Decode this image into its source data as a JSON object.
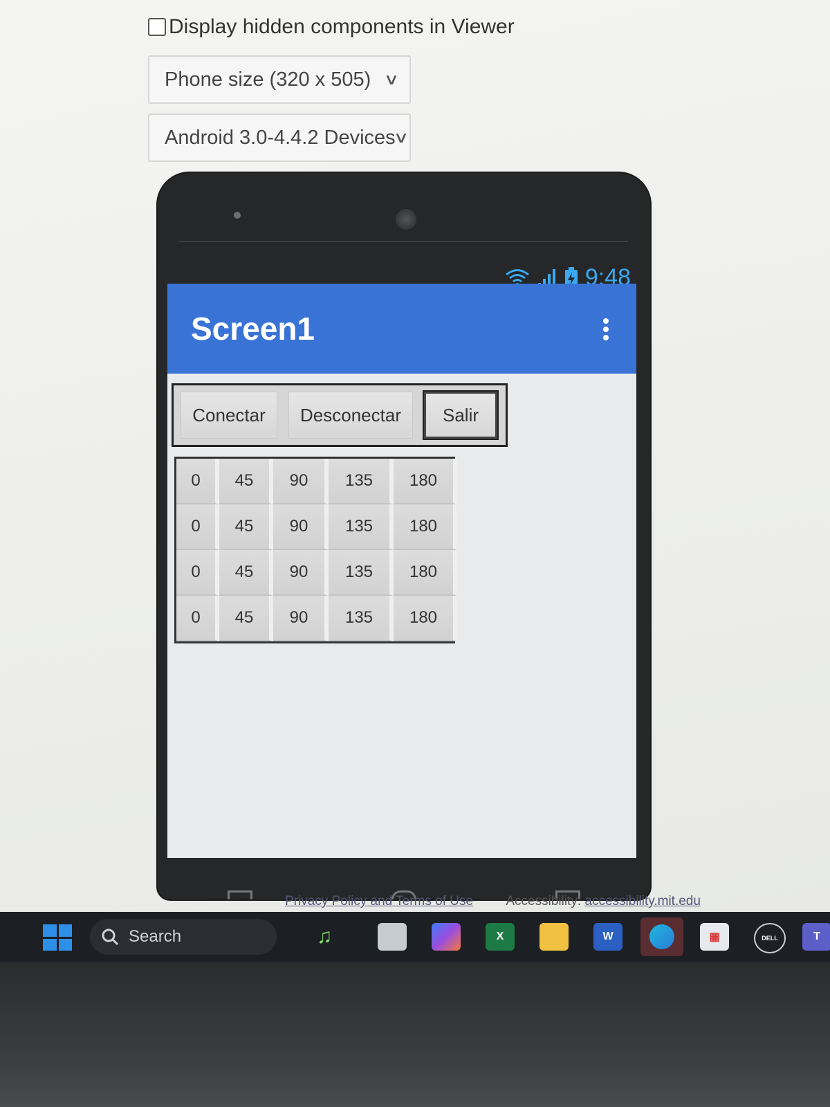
{
  "viewer": {
    "hidden_components_label": "Display hidden components in Viewer",
    "phone_size": "Phone size (320 x 505)",
    "device": "Android 3.0-4.4.2 Devices"
  },
  "phone": {
    "status_time": "9:48",
    "screen_title": "Screen1",
    "buttons": [
      "Conectar",
      "Desconectar",
      "Salir"
    ],
    "grid": [
      [
        "0",
        "45",
        "90",
        "135",
        "180"
      ],
      [
        "0",
        "45",
        "90",
        "135",
        "180"
      ],
      [
        "0",
        "45",
        "90",
        "135",
        "180"
      ],
      [
        "0",
        "45",
        "90",
        "135",
        "180"
      ]
    ]
  },
  "footer": {
    "privacy": "Privacy Policy and Terms of Use",
    "accessibility_label": "Accessibility:",
    "accessibility_link": "accessibility.mit.edu"
  },
  "taskbar": {
    "search_label": "Search",
    "apps": [
      "accessibility-icon",
      "copilot-icon",
      "excel-icon",
      "file-explorer-icon",
      "word-icon",
      "edge-icon",
      "store-icon",
      "dell-icon",
      "teams-icon"
    ]
  },
  "colors": {
    "app_bar": "#3a73d6",
    "status_icons": "#3aa9f1",
    "taskbar": "#1c1f24"
  }
}
